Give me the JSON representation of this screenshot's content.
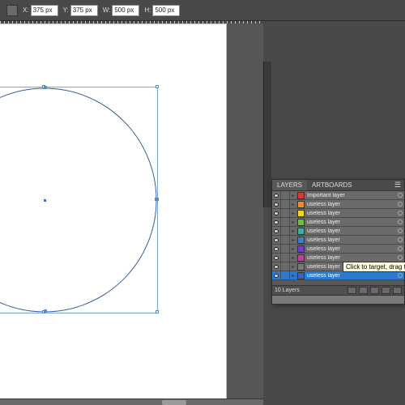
{
  "options_bar": {
    "x": {
      "label": "X:",
      "value": "375 px"
    },
    "y": {
      "label": "Y:",
      "value": "375 px"
    },
    "w": {
      "label": "W:",
      "value": "500 px"
    },
    "h": {
      "label": "H:",
      "value": "500 px"
    }
  },
  "layers_panel": {
    "tabs": {
      "layers": "LAYERS",
      "artboards": "ARTBOARDS"
    },
    "menu_glyph": "☰",
    "rows": [
      {
        "name": "Important layer",
        "color": "#d43a3a",
        "selected": false
      },
      {
        "name": "useless layer",
        "color": "#f28c28",
        "selected": false
      },
      {
        "name": "useless layer",
        "color": "#f2d42d",
        "selected": false
      },
      {
        "name": "useless layer",
        "color": "#6fbf3f",
        "selected": false
      },
      {
        "name": "useless layer",
        "color": "#3fae9e",
        "selected": false
      },
      {
        "name": "useless layer",
        "color": "#3f7dbf",
        "selected": false
      },
      {
        "name": "useless layer",
        "color": "#6f3fbf",
        "selected": false
      },
      {
        "name": "useless layer",
        "color": "#bf3f9e",
        "selected": false
      },
      {
        "name": "useless layer",
        "color": "#7a7a7a",
        "selected": false
      },
      {
        "name": "useless layer",
        "color": "#3f60bf",
        "selected": true
      }
    ],
    "count_label": "10 Layers",
    "tooltip_text": "Click to target, drag to move appear"
  }
}
